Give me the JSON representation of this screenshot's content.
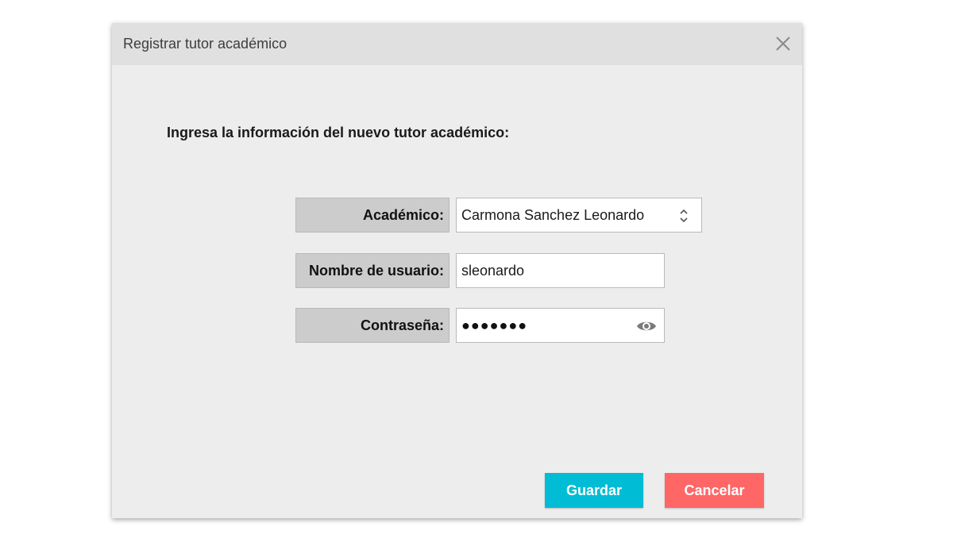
{
  "dialog": {
    "title": "Registrar tutor académico",
    "instructions": "Ingresa la información del nuevo tutor académico:"
  },
  "form": {
    "academico": {
      "label": "Académico:",
      "selected_value": "Carmona Sanchez Leonardo"
    },
    "usuario": {
      "label": "Nombre de usuario:",
      "value": "sleonardo"
    },
    "contrasena": {
      "label": "Contraseña:",
      "masked_value": "●●●●●●●"
    }
  },
  "buttons": {
    "save_label": "Guardar",
    "cancel_label": "Cancelar"
  },
  "icons": {
    "close": "close-icon",
    "select_arrows": "chevron-up-down-icon",
    "show_password": "eye-icon"
  },
  "colors": {
    "save_button": "#00bcd4",
    "cancel_button": "#ff6666",
    "dialog_background": "#ededed",
    "titlebar_background": "#e0e0e0",
    "label_background": "#cccccc"
  }
}
